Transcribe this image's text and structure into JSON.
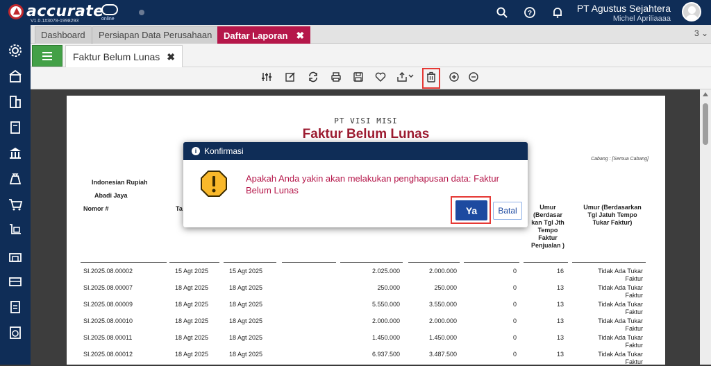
{
  "app": {
    "logo_text": "accurate",
    "logo_sub": "online",
    "version": "V1.0.1#3078-1998293",
    "company_name": "PT Agustus Sejahtera",
    "user_name": "Michel Apriliaaaa"
  },
  "tabs": [
    {
      "label": "Dashboard"
    },
    {
      "label": "Persiapan Data Perusahaan"
    },
    {
      "label": "Daftar Laporan",
      "close": "✖"
    }
  ],
  "tab_count": "3 ⌄",
  "subtab": {
    "label": "Faktur Belum Lunas",
    "close": "✖"
  },
  "toolbar": {
    "icons": [
      "sliders-icon",
      "edit-icon",
      "refresh-icon",
      "print-icon",
      "save-icon",
      "favorite-icon",
      "export-icon",
      "delete-icon",
      "zoom-in-icon",
      "zoom-out-icon"
    ]
  },
  "report": {
    "company": "PT VISI MISI",
    "title": "Faktur Belum Lunas",
    "cabang": "Cabang : [Semua Cabang]",
    "currency": "Indonesian Rupiah",
    "group": "Abadi Jaya",
    "col_nomor": "Nomor #",
    "col_tanggal_partial": "Ta",
    "col_umur1": "Umur (Berdasar kan Tgl Jth Tempo Faktur Penjualan )",
    "col_umur2": "Umur (Berdasarkan Tgl Jatuh Tempo Tukar Faktur)",
    "rows": [
      {
        "no": "SI.2025.08.00002",
        "tgl": "15 Agt 2025",
        "jt": "15 Agt 2025",
        "nilai": "2.025.000",
        "sisa": "2.000.000",
        "x": "0",
        "umur": "16",
        "ket": "Tidak Ada Tukar Faktur"
      },
      {
        "no": "SI.2025.08.00007",
        "tgl": "18 Agt 2025",
        "jt": "18 Agt 2025",
        "nilai": "250.000",
        "sisa": "250.000",
        "x": "0",
        "umur": "13",
        "ket": "Tidak Ada Tukar Faktur"
      },
      {
        "no": "SI.2025.08.00009",
        "tgl": "18 Agt 2025",
        "jt": "18 Agt 2025",
        "nilai": "5.550.000",
        "sisa": "3.550.000",
        "x": "0",
        "umur": "13",
        "ket": "Tidak Ada Tukar Faktur"
      },
      {
        "no": "SI.2025.08.00010",
        "tgl": "18 Agt 2025",
        "jt": "18 Agt 2025",
        "nilai": "2.000.000",
        "sisa": "2.000.000",
        "x": "0",
        "umur": "13",
        "ket": "Tidak Ada Tukar Faktur"
      },
      {
        "no": "SI.2025.08.00011",
        "tgl": "18 Agt 2025",
        "jt": "18 Agt 2025",
        "nilai": "1.450.000",
        "sisa": "1.450.000",
        "x": "0",
        "umur": "13",
        "ket": "Tidak Ada Tukar Faktur"
      },
      {
        "no": "SI.2025.08.00012",
        "tgl": "18 Agt 2025",
        "jt": "18 Agt 2025",
        "nilai": "6.937.500",
        "sisa": "3.487.500",
        "x": "0",
        "umur": "13",
        "ket": "Tidak Ada Tukar Faktur"
      }
    ]
  },
  "dialog": {
    "title": "Konfirmasi",
    "message": "Apakah Anda yakin akan melakukan penghapusan data: Faktur Belum Lunas",
    "yes_label": "Ya",
    "cancel_label": "Batal"
  },
  "colors": {
    "header": "#0f2d57",
    "active_tab": "#b5174a",
    "report_title": "#9c1b30",
    "primary_button": "#1d4aa0",
    "highlight": "#e53935"
  }
}
